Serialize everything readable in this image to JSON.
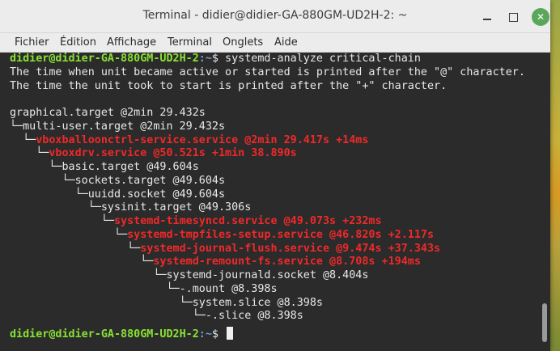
{
  "window": {
    "title": "Terminal - didier@didier-GA-880GM-UD2H-2: ~",
    "min_glyph": "",
    "close_glyph": "✕"
  },
  "menu": [
    "Fichier",
    "Édition",
    "Affichage",
    "Terminal",
    "Onglets",
    "Aide"
  ],
  "terminal": {
    "prompt_user": "didier@didier-GA-880GM-UD2H-2",
    "prompt_path": ":~",
    "prompt_symbol": "$",
    "command": " systemd-analyze critical-chain",
    "info_line_1": "The time when unit became active or started is printed after the \"@\" character.",
    "info_line_2": "The time the unit took to start is printed after the \"+\" character.",
    "chain": [
      {
        "prefix": "",
        "text": "graphical.target @2min 29.432s",
        "style": "white"
      },
      {
        "prefix": "└─",
        "text": "multi-user.target @2min 29.432s",
        "style": "white"
      },
      {
        "prefix": "  └─",
        "text": "vboxballoonctrl-service.service @2min 29.417s +14ms",
        "style": "red"
      },
      {
        "prefix": "    └─",
        "text": "vboxdrv.service @50.521s +1min 38.890s",
        "style": "red"
      },
      {
        "prefix": "      └─",
        "text": "basic.target @49.604s",
        "style": "white"
      },
      {
        "prefix": "        └─",
        "text": "sockets.target @49.604s",
        "style": "white"
      },
      {
        "prefix": "          └─",
        "text": "uuidd.socket @49.604s",
        "style": "white"
      },
      {
        "prefix": "            └─",
        "text": "sysinit.target @49.306s",
        "style": "white"
      },
      {
        "prefix": "              └─",
        "text": "systemd-timesyncd.service @49.073s +232ms",
        "style": "red"
      },
      {
        "prefix": "                └─",
        "text": "systemd-tmpfiles-setup.service @46.820s +2.117s",
        "style": "red"
      },
      {
        "prefix": "                  └─",
        "text": "systemd-journal-flush.service @9.474s +37.343s",
        "style": "red"
      },
      {
        "prefix": "                    └─",
        "text": "systemd-remount-fs.service @8.708s +194ms",
        "style": "red"
      },
      {
        "prefix": "                      └─",
        "text": "systemd-journald.socket @8.404s",
        "style": "white"
      },
      {
        "prefix": "                        └─",
        "text": "-.mount @8.398s",
        "style": "white"
      },
      {
        "prefix": "                          └─",
        "text": "system.slice @8.398s",
        "style": "white"
      },
      {
        "prefix": "                            └─",
        "text": "-.slice @8.398s",
        "style": "white"
      }
    ]
  }
}
